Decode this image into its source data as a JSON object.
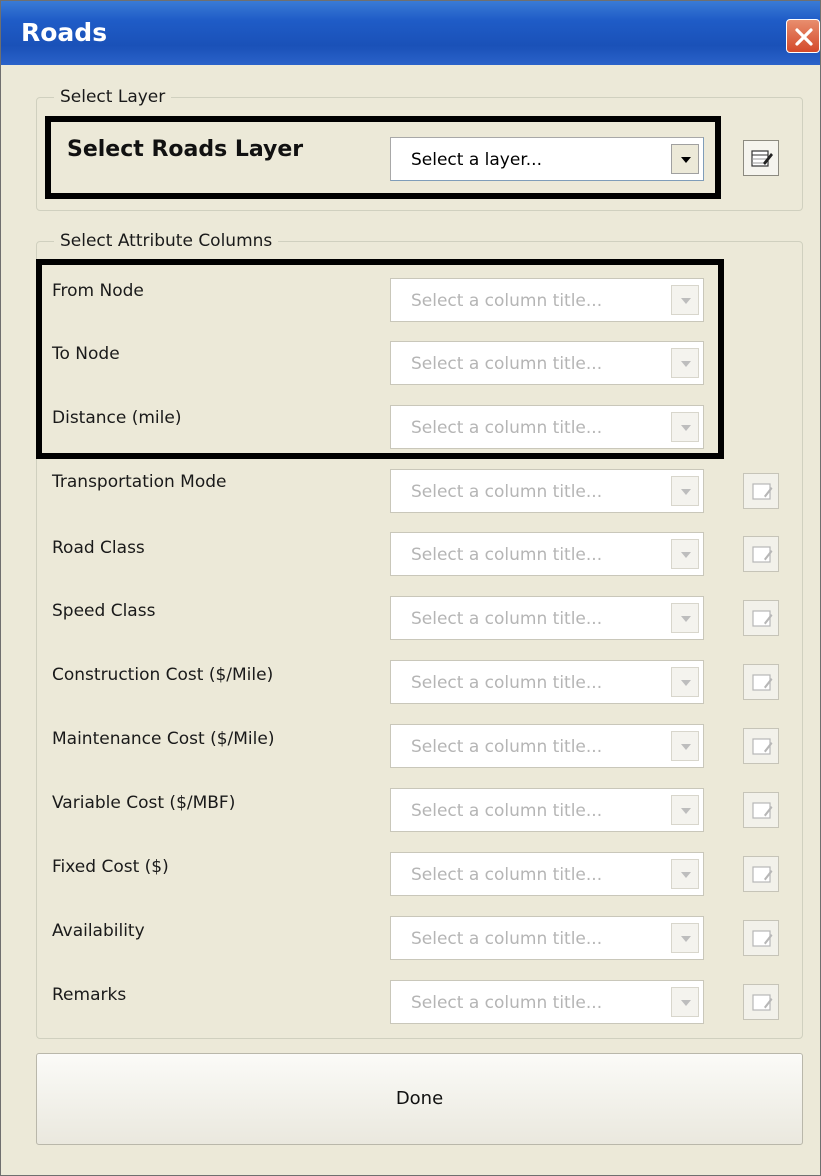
{
  "window": {
    "title": "Roads"
  },
  "select_layer": {
    "group_label": "Select Layer",
    "label": "Select Roads Layer",
    "combo_value": "Select a layer..."
  },
  "attributes": {
    "group_label": "Select Attribute Columns",
    "placeholder": "Select a column title...",
    "rows": [
      {
        "label": "From Node"
      },
      {
        "label": "To Node"
      },
      {
        "label": "Distance (mile)"
      },
      {
        "label": "Transportation Mode"
      },
      {
        "label": "Road Class"
      },
      {
        "label": "Speed Class"
      },
      {
        "label": "Construction Cost ($/Mile)"
      },
      {
        "label": "Maintenance Cost ($/Mile)"
      },
      {
        "label": "Variable Cost ($/MBF)"
      },
      {
        "label": "Fixed Cost ($)"
      },
      {
        "label": "Availability"
      },
      {
        "label": "Remarks"
      }
    ]
  },
  "footer": {
    "done_label": "Done"
  },
  "colors": {
    "titlebar": "#1f5cc7",
    "dialog_bg": "#ece9d8",
    "close": "#d4492a",
    "highlight": "#000000"
  }
}
